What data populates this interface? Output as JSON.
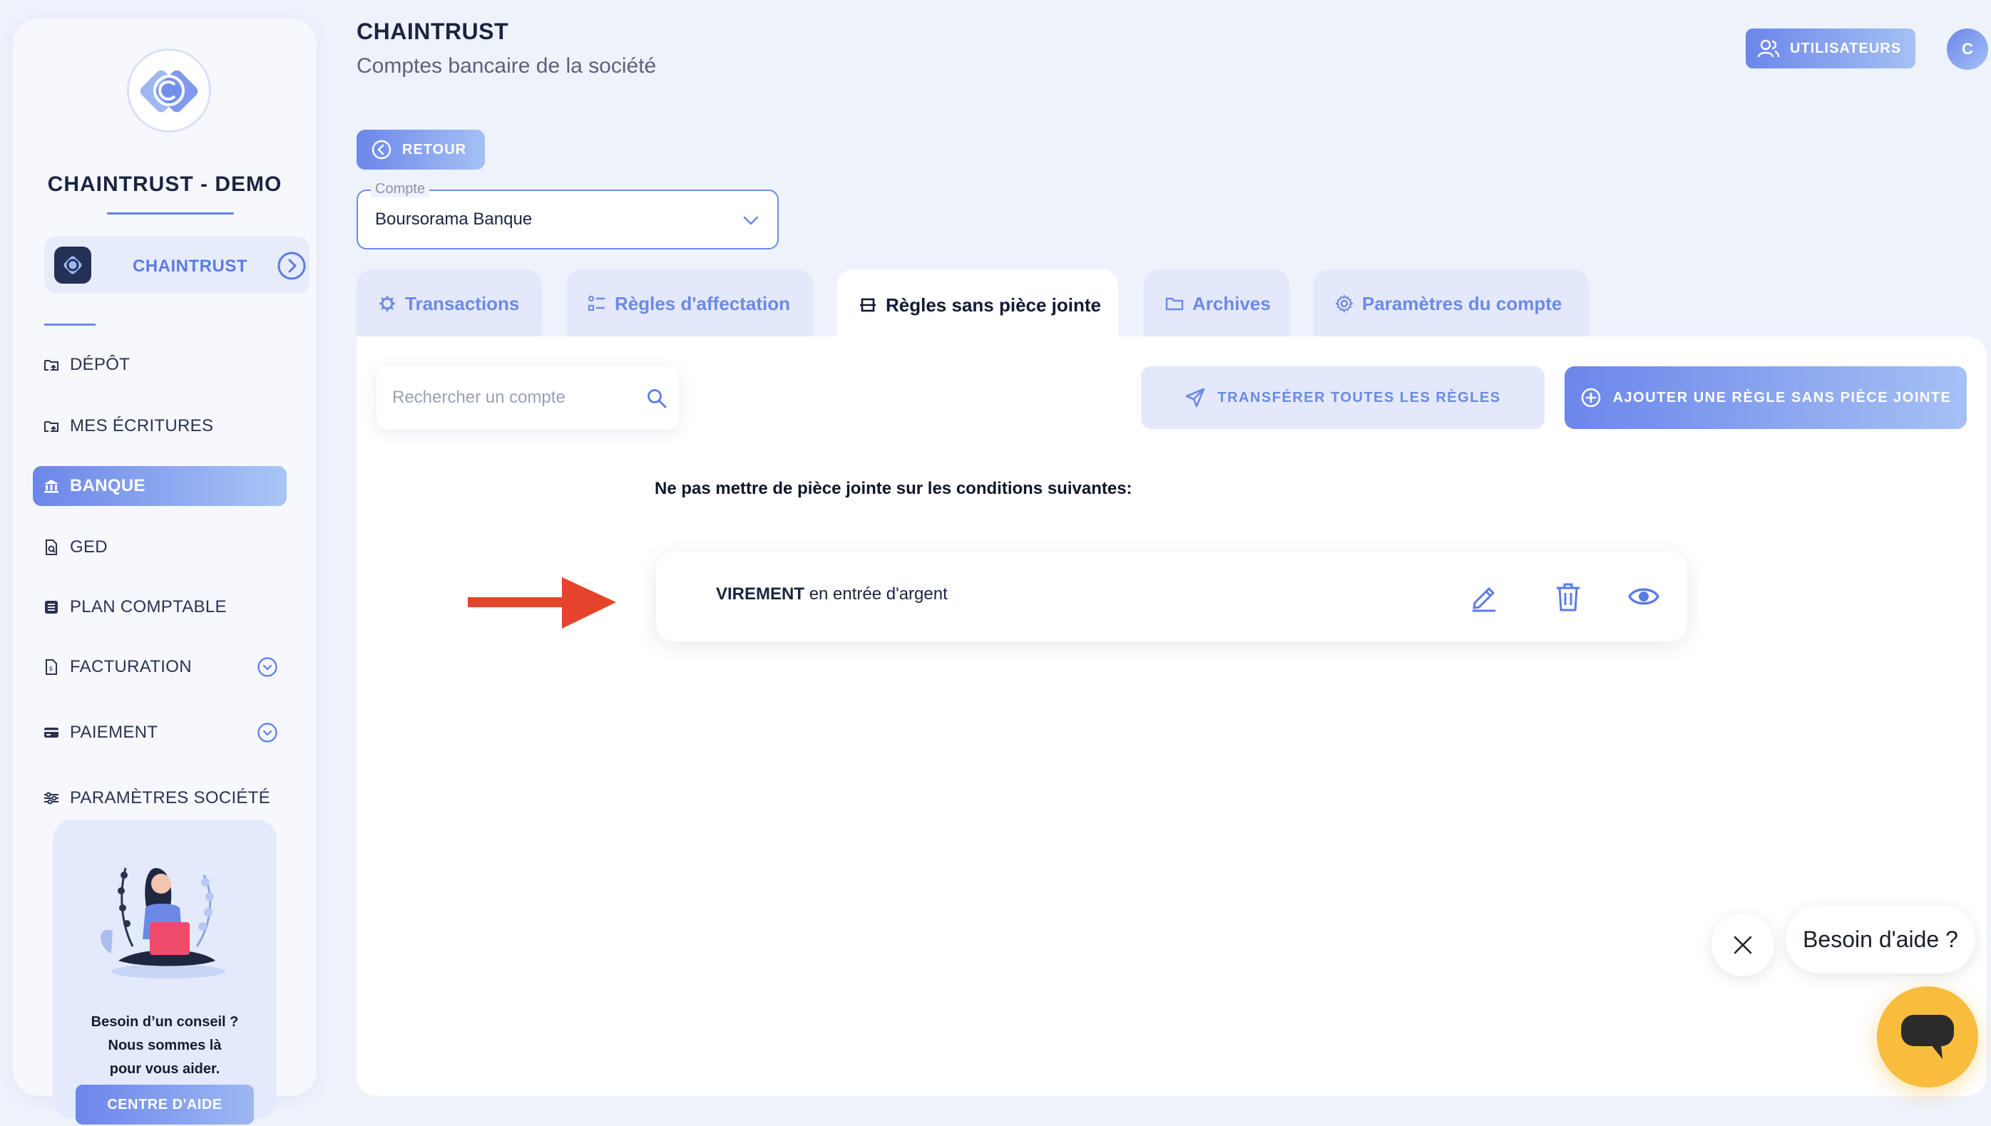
{
  "sidebar": {
    "org_title": "CHAINTRUST - DEMO",
    "company_label": "CHAINTRUST",
    "items": [
      {
        "label": "DÉPÔT",
        "icon": "folder-upload-icon"
      },
      {
        "label": "MES ÉCRITURES",
        "icon": "folder-upload-icon"
      },
      {
        "label": "BANQUE",
        "icon": "bank-icon",
        "active": true
      },
      {
        "label": "GED",
        "icon": "document-search-icon"
      },
      {
        "label": "PLAN COMPTABLE",
        "icon": "ledger-icon"
      },
      {
        "label": "FACTURATION",
        "icon": "invoice-icon",
        "expandable": true
      },
      {
        "label": "PAIEMENT",
        "icon": "card-icon",
        "expandable": true
      },
      {
        "label": "PARAMÈTRES SOCIÉTÉ",
        "icon": "sliders-icon"
      }
    ],
    "help_card": {
      "line1": "Besoin d’un conseil ?",
      "line2": "Nous sommes là",
      "line3": "pour vous aider.",
      "button_label": "CENTRE D'AIDE"
    }
  },
  "header": {
    "title": "CHAINTRUST",
    "subtitle": "Comptes bancaire de la société",
    "users_button": "UTILISATEURS",
    "avatar_initial": "C"
  },
  "back_button": "RETOUR",
  "account_select": {
    "legend": "Compte",
    "value": "Boursorama Banque"
  },
  "tabs": [
    {
      "label": "Transactions",
      "icon": "gear-sparkle-icon"
    },
    {
      "label": "Règles d'affectation",
      "icon": "list-rules-icon"
    },
    {
      "label": "Règles sans pièce jointe",
      "icon": "no-attachment-icon",
      "active": true
    },
    {
      "label": "Archives",
      "icon": "folder-icon"
    },
    {
      "label": "Paramètres du compte",
      "icon": "gear-icon"
    }
  ],
  "toolbar": {
    "search_placeholder": "Rechercher un compte",
    "transfer_label": "TRANSFÉRER TOUTES LES RÈGLES",
    "add_label": "AJOUTER UNE RÈGLE SANS PIÈCE JOINTE"
  },
  "rules": {
    "title": "Ne pas mettre de pièce jointe sur les conditions suivantes:",
    "items": [
      {
        "keyword": "VIREMENT",
        "condition": "en entrée d'argent"
      }
    ]
  },
  "chat": {
    "bubble_text": "Besoin d'aide ?"
  },
  "colors": {
    "accent": "#6b86ea",
    "accent_light": "#a5c1f4",
    "tab_bg": "#e3e9fa",
    "page_bg": "#eef2fb",
    "chat_yellow": "#f8bd3d",
    "annotation_red": "#e5432b"
  }
}
